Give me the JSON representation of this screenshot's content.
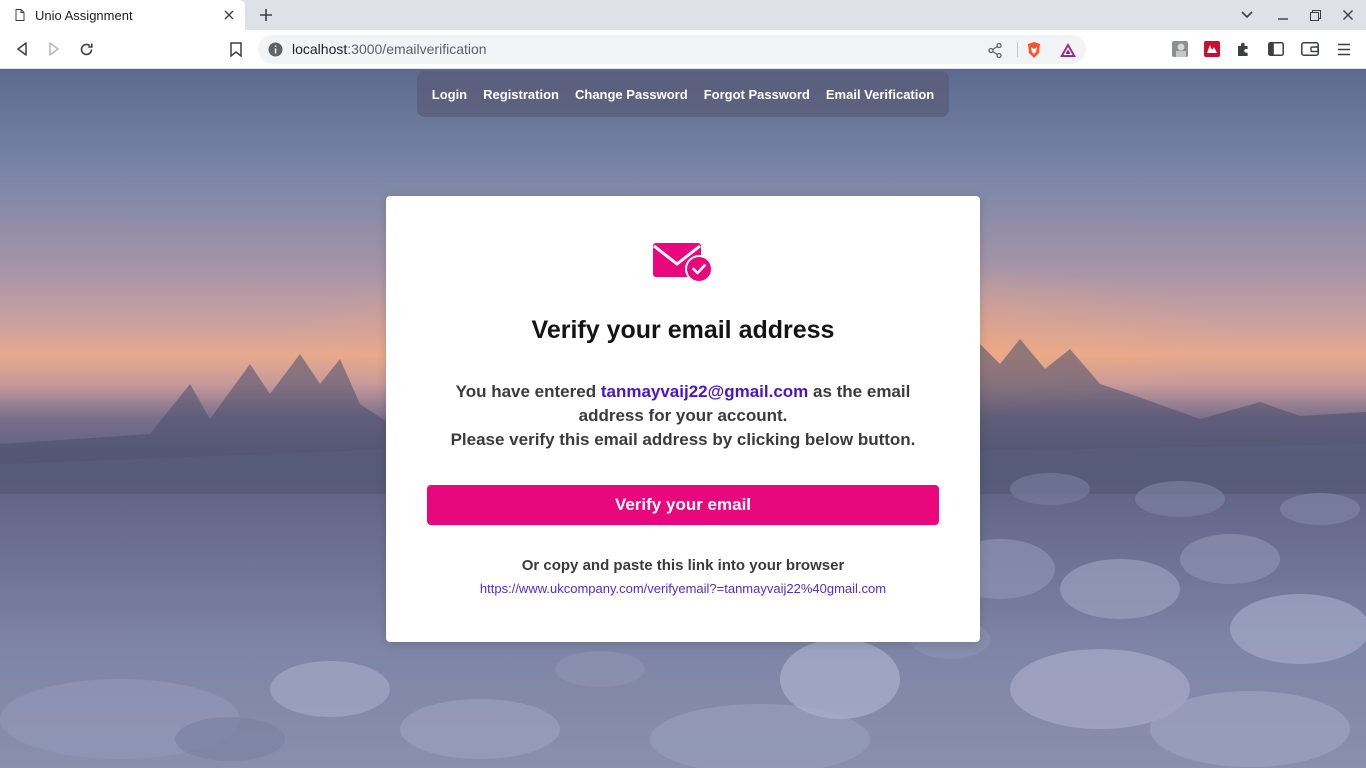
{
  "browser": {
    "tab_title": "Unio Assignment",
    "url_host": "localhost",
    "url_path": ":3000/emailverification"
  },
  "nav": {
    "items": [
      "Login",
      "Registration",
      "Change Password",
      "Forgot Password",
      "Email Verification"
    ]
  },
  "card": {
    "heading": "Verify your email address",
    "message_prefix": "You have entered ",
    "email": "tanmayvaij22@gmail.com",
    "message_suffix": " as the email address for your account.",
    "message_line2": "Please verify this email address by clicking below button.",
    "button_label": "Verify your email",
    "alt_text": "Or copy and paste this link into your browser",
    "verify_link": "https://www.ukcompany.com/verifyemail?=tanmayvaij22%40gmail.com"
  },
  "colors": {
    "accent": "#e8077d",
    "email_text": "#4b14c8",
    "link": "#4b2ed6"
  }
}
